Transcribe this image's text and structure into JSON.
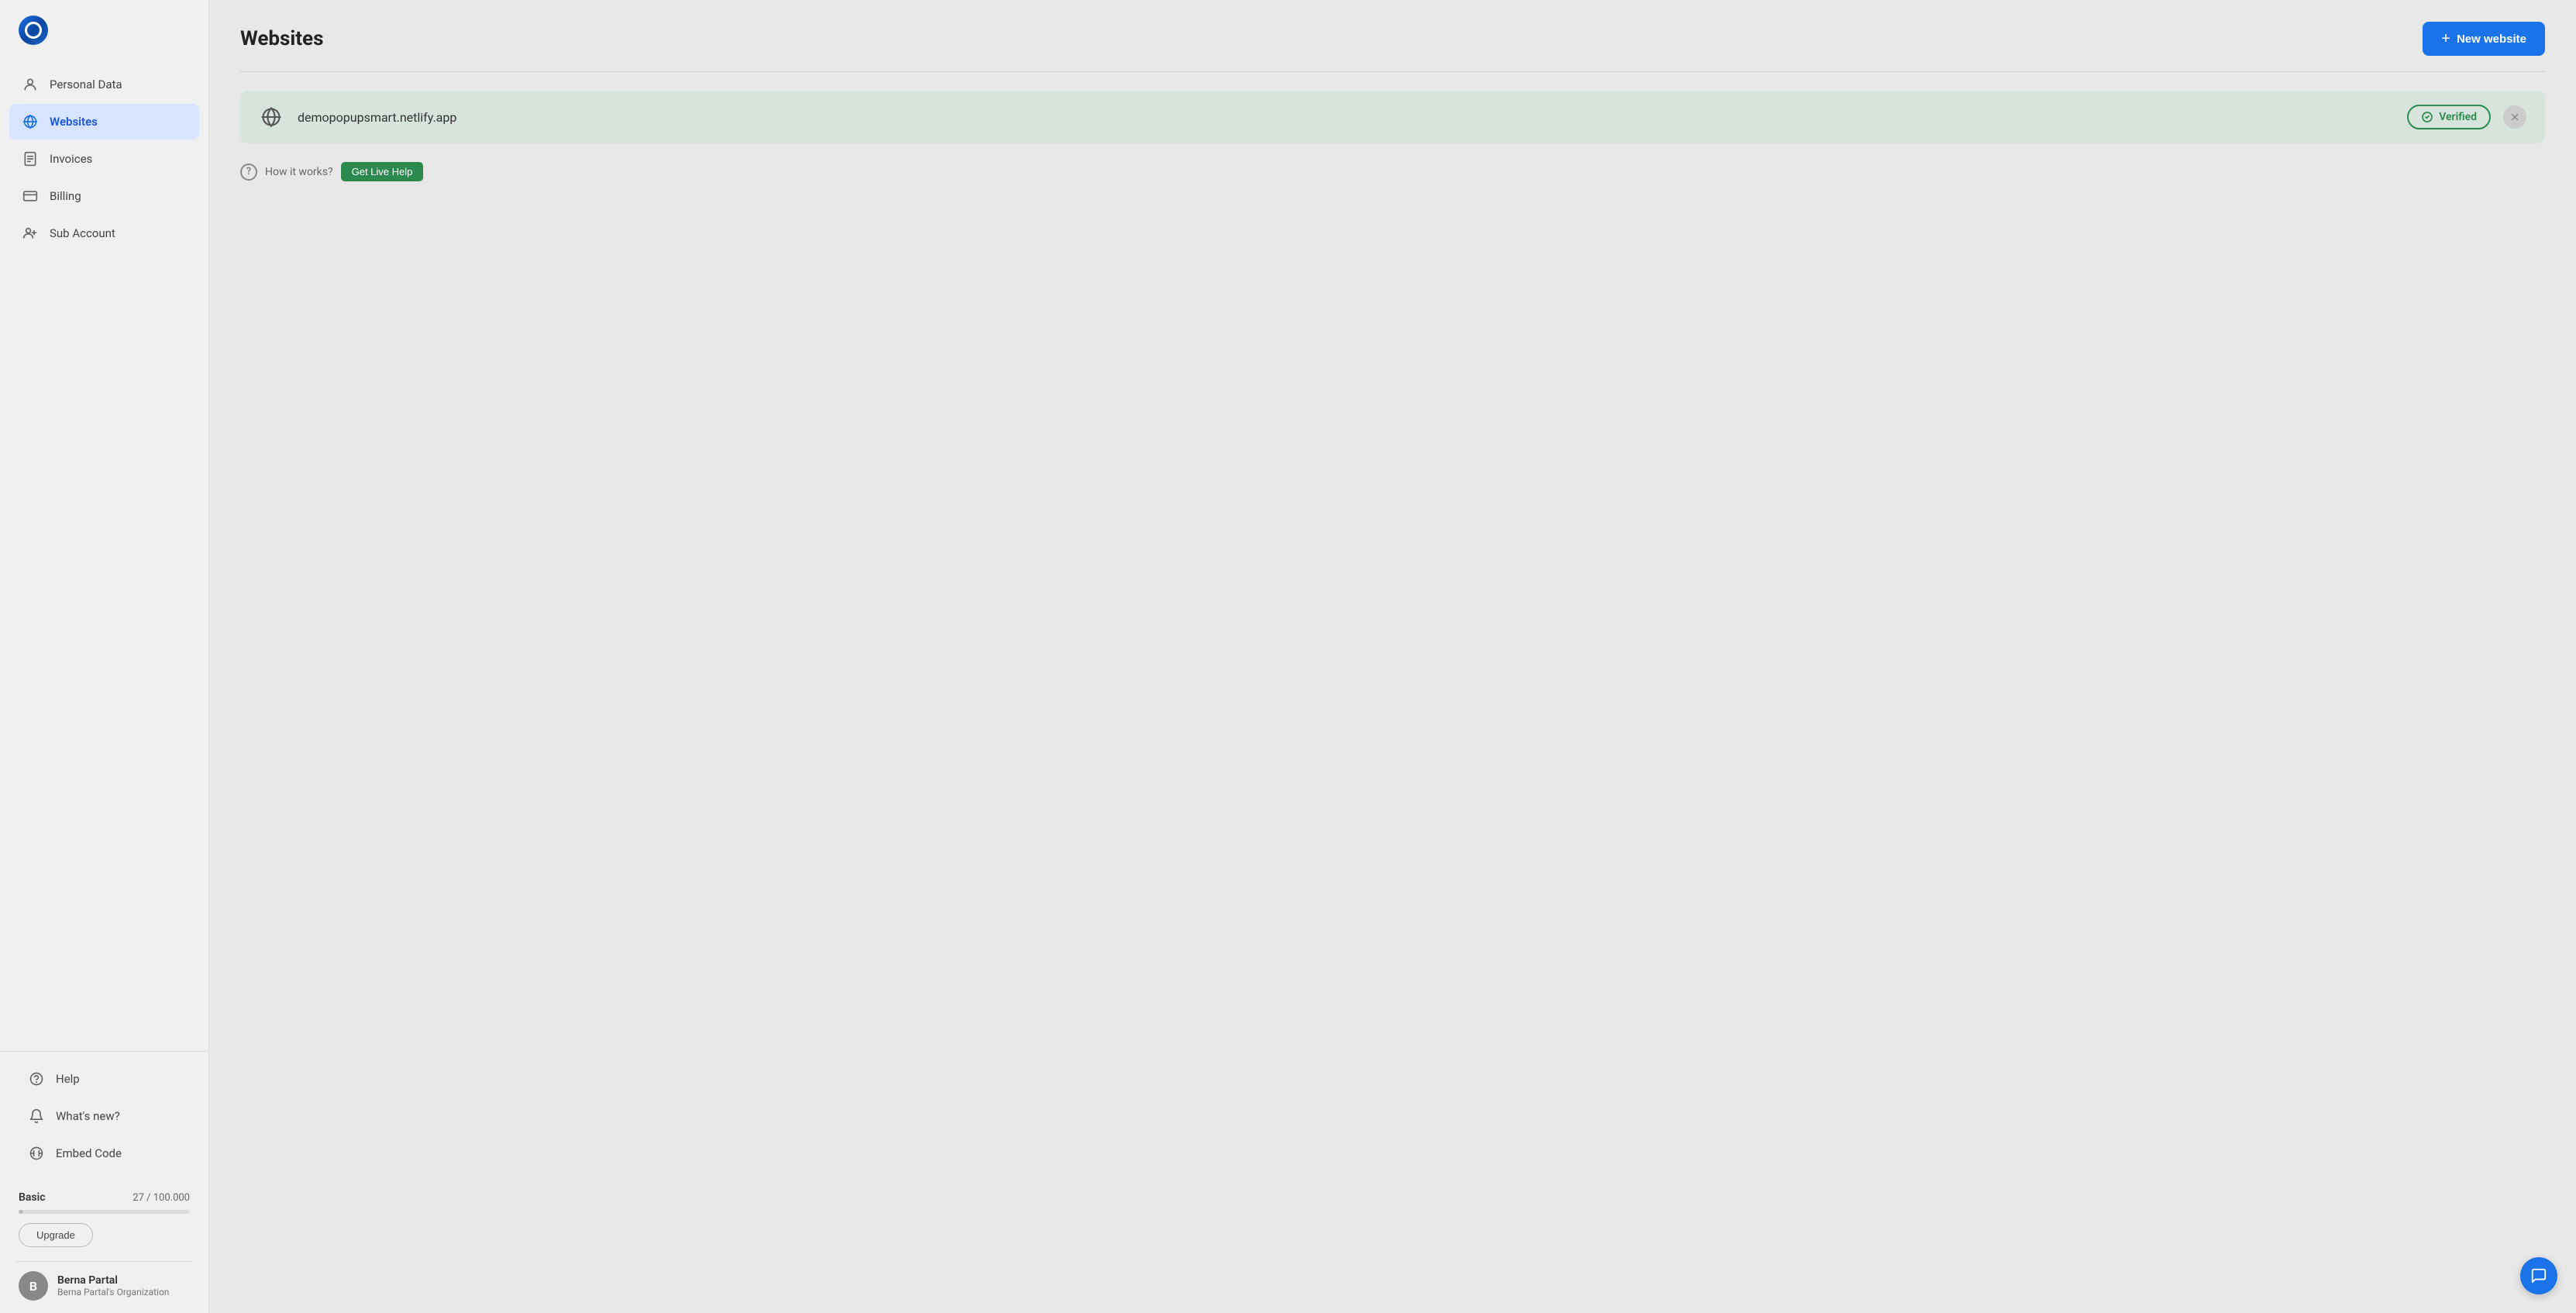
{
  "sidebar": {
    "logo_alt": "Popupsmart logo",
    "nav_items": [
      {
        "id": "personal-data",
        "label": "Personal Data",
        "active": false
      },
      {
        "id": "websites",
        "label": "Websites",
        "active": true
      },
      {
        "id": "invoices",
        "label": "Invoices",
        "active": false
      },
      {
        "id": "billing",
        "label": "Billing",
        "active": false
      },
      {
        "id": "sub-account",
        "label": "Sub Account",
        "active": false
      }
    ],
    "bottom_nav": [
      {
        "id": "help",
        "label": "Help"
      },
      {
        "id": "whats-new",
        "label": "What's new?"
      },
      {
        "id": "embed-code",
        "label": "Embed Code"
      }
    ],
    "plan": {
      "name": "Basic",
      "usage": "27 / 100.000",
      "percent": 0.027,
      "upgrade_label": "Upgrade"
    },
    "user": {
      "name": "Berna Partal",
      "org": "Berna Partal's Organization",
      "avatar_initials": "B"
    }
  },
  "header": {
    "title": "Websites",
    "new_website_label": "New website"
  },
  "website": {
    "url": "demopopupsmart.netlify.app",
    "verified_label": "Verified"
  },
  "how_it_works": {
    "text": "How it works?",
    "live_help_label": "Get Live Help"
  },
  "colors": {
    "accent_blue": "#1a73e8",
    "verified_green": "#2d8a4e",
    "website_row_bg": "#d6e4dc"
  }
}
